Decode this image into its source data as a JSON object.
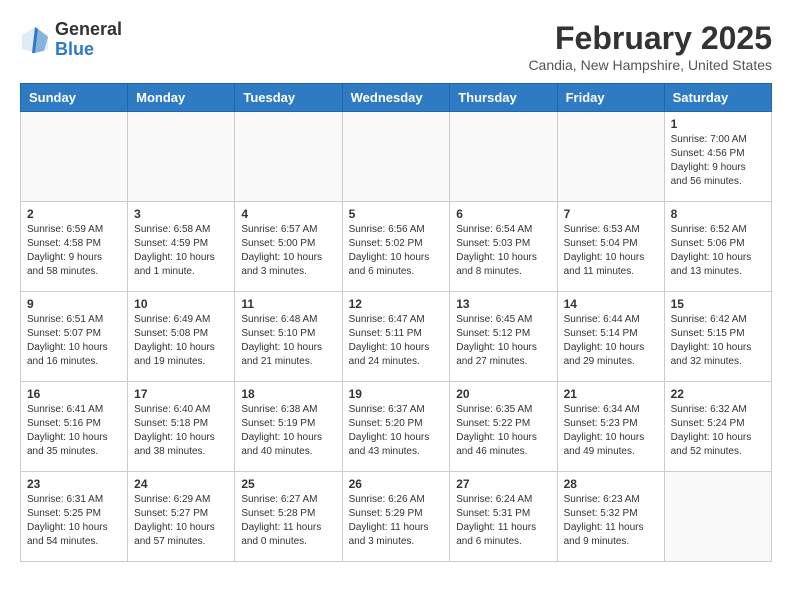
{
  "header": {
    "logo_general": "General",
    "logo_blue": "Blue",
    "title": "February 2025",
    "subtitle": "Candia, New Hampshire, United States"
  },
  "weekdays": [
    "Sunday",
    "Monday",
    "Tuesday",
    "Wednesday",
    "Thursday",
    "Friday",
    "Saturday"
  ],
  "weeks": [
    [
      {
        "num": "",
        "info": ""
      },
      {
        "num": "",
        "info": ""
      },
      {
        "num": "",
        "info": ""
      },
      {
        "num": "",
        "info": ""
      },
      {
        "num": "",
        "info": ""
      },
      {
        "num": "",
        "info": ""
      },
      {
        "num": "1",
        "info": "Sunrise: 7:00 AM\nSunset: 4:56 PM\nDaylight: 9 hours and 56 minutes."
      }
    ],
    [
      {
        "num": "2",
        "info": "Sunrise: 6:59 AM\nSunset: 4:58 PM\nDaylight: 9 hours and 58 minutes."
      },
      {
        "num": "3",
        "info": "Sunrise: 6:58 AM\nSunset: 4:59 PM\nDaylight: 10 hours and 1 minute."
      },
      {
        "num": "4",
        "info": "Sunrise: 6:57 AM\nSunset: 5:00 PM\nDaylight: 10 hours and 3 minutes."
      },
      {
        "num": "5",
        "info": "Sunrise: 6:56 AM\nSunset: 5:02 PM\nDaylight: 10 hours and 6 minutes."
      },
      {
        "num": "6",
        "info": "Sunrise: 6:54 AM\nSunset: 5:03 PM\nDaylight: 10 hours and 8 minutes."
      },
      {
        "num": "7",
        "info": "Sunrise: 6:53 AM\nSunset: 5:04 PM\nDaylight: 10 hours and 11 minutes."
      },
      {
        "num": "8",
        "info": "Sunrise: 6:52 AM\nSunset: 5:06 PM\nDaylight: 10 hours and 13 minutes."
      }
    ],
    [
      {
        "num": "9",
        "info": "Sunrise: 6:51 AM\nSunset: 5:07 PM\nDaylight: 10 hours and 16 minutes."
      },
      {
        "num": "10",
        "info": "Sunrise: 6:49 AM\nSunset: 5:08 PM\nDaylight: 10 hours and 19 minutes."
      },
      {
        "num": "11",
        "info": "Sunrise: 6:48 AM\nSunset: 5:10 PM\nDaylight: 10 hours and 21 minutes."
      },
      {
        "num": "12",
        "info": "Sunrise: 6:47 AM\nSunset: 5:11 PM\nDaylight: 10 hours and 24 minutes."
      },
      {
        "num": "13",
        "info": "Sunrise: 6:45 AM\nSunset: 5:12 PM\nDaylight: 10 hours and 27 minutes."
      },
      {
        "num": "14",
        "info": "Sunrise: 6:44 AM\nSunset: 5:14 PM\nDaylight: 10 hours and 29 minutes."
      },
      {
        "num": "15",
        "info": "Sunrise: 6:42 AM\nSunset: 5:15 PM\nDaylight: 10 hours and 32 minutes."
      }
    ],
    [
      {
        "num": "16",
        "info": "Sunrise: 6:41 AM\nSunset: 5:16 PM\nDaylight: 10 hours and 35 minutes."
      },
      {
        "num": "17",
        "info": "Sunrise: 6:40 AM\nSunset: 5:18 PM\nDaylight: 10 hours and 38 minutes."
      },
      {
        "num": "18",
        "info": "Sunrise: 6:38 AM\nSunset: 5:19 PM\nDaylight: 10 hours and 40 minutes."
      },
      {
        "num": "19",
        "info": "Sunrise: 6:37 AM\nSunset: 5:20 PM\nDaylight: 10 hours and 43 minutes."
      },
      {
        "num": "20",
        "info": "Sunrise: 6:35 AM\nSunset: 5:22 PM\nDaylight: 10 hours and 46 minutes."
      },
      {
        "num": "21",
        "info": "Sunrise: 6:34 AM\nSunset: 5:23 PM\nDaylight: 10 hours and 49 minutes."
      },
      {
        "num": "22",
        "info": "Sunrise: 6:32 AM\nSunset: 5:24 PM\nDaylight: 10 hours and 52 minutes."
      }
    ],
    [
      {
        "num": "23",
        "info": "Sunrise: 6:31 AM\nSunset: 5:25 PM\nDaylight: 10 hours and 54 minutes."
      },
      {
        "num": "24",
        "info": "Sunrise: 6:29 AM\nSunset: 5:27 PM\nDaylight: 10 hours and 57 minutes."
      },
      {
        "num": "25",
        "info": "Sunrise: 6:27 AM\nSunset: 5:28 PM\nDaylight: 11 hours and 0 minutes."
      },
      {
        "num": "26",
        "info": "Sunrise: 6:26 AM\nSunset: 5:29 PM\nDaylight: 11 hours and 3 minutes."
      },
      {
        "num": "27",
        "info": "Sunrise: 6:24 AM\nSunset: 5:31 PM\nDaylight: 11 hours and 6 minutes."
      },
      {
        "num": "28",
        "info": "Sunrise: 6:23 AM\nSunset: 5:32 PM\nDaylight: 11 hours and 9 minutes."
      },
      {
        "num": "",
        "info": ""
      }
    ]
  ]
}
